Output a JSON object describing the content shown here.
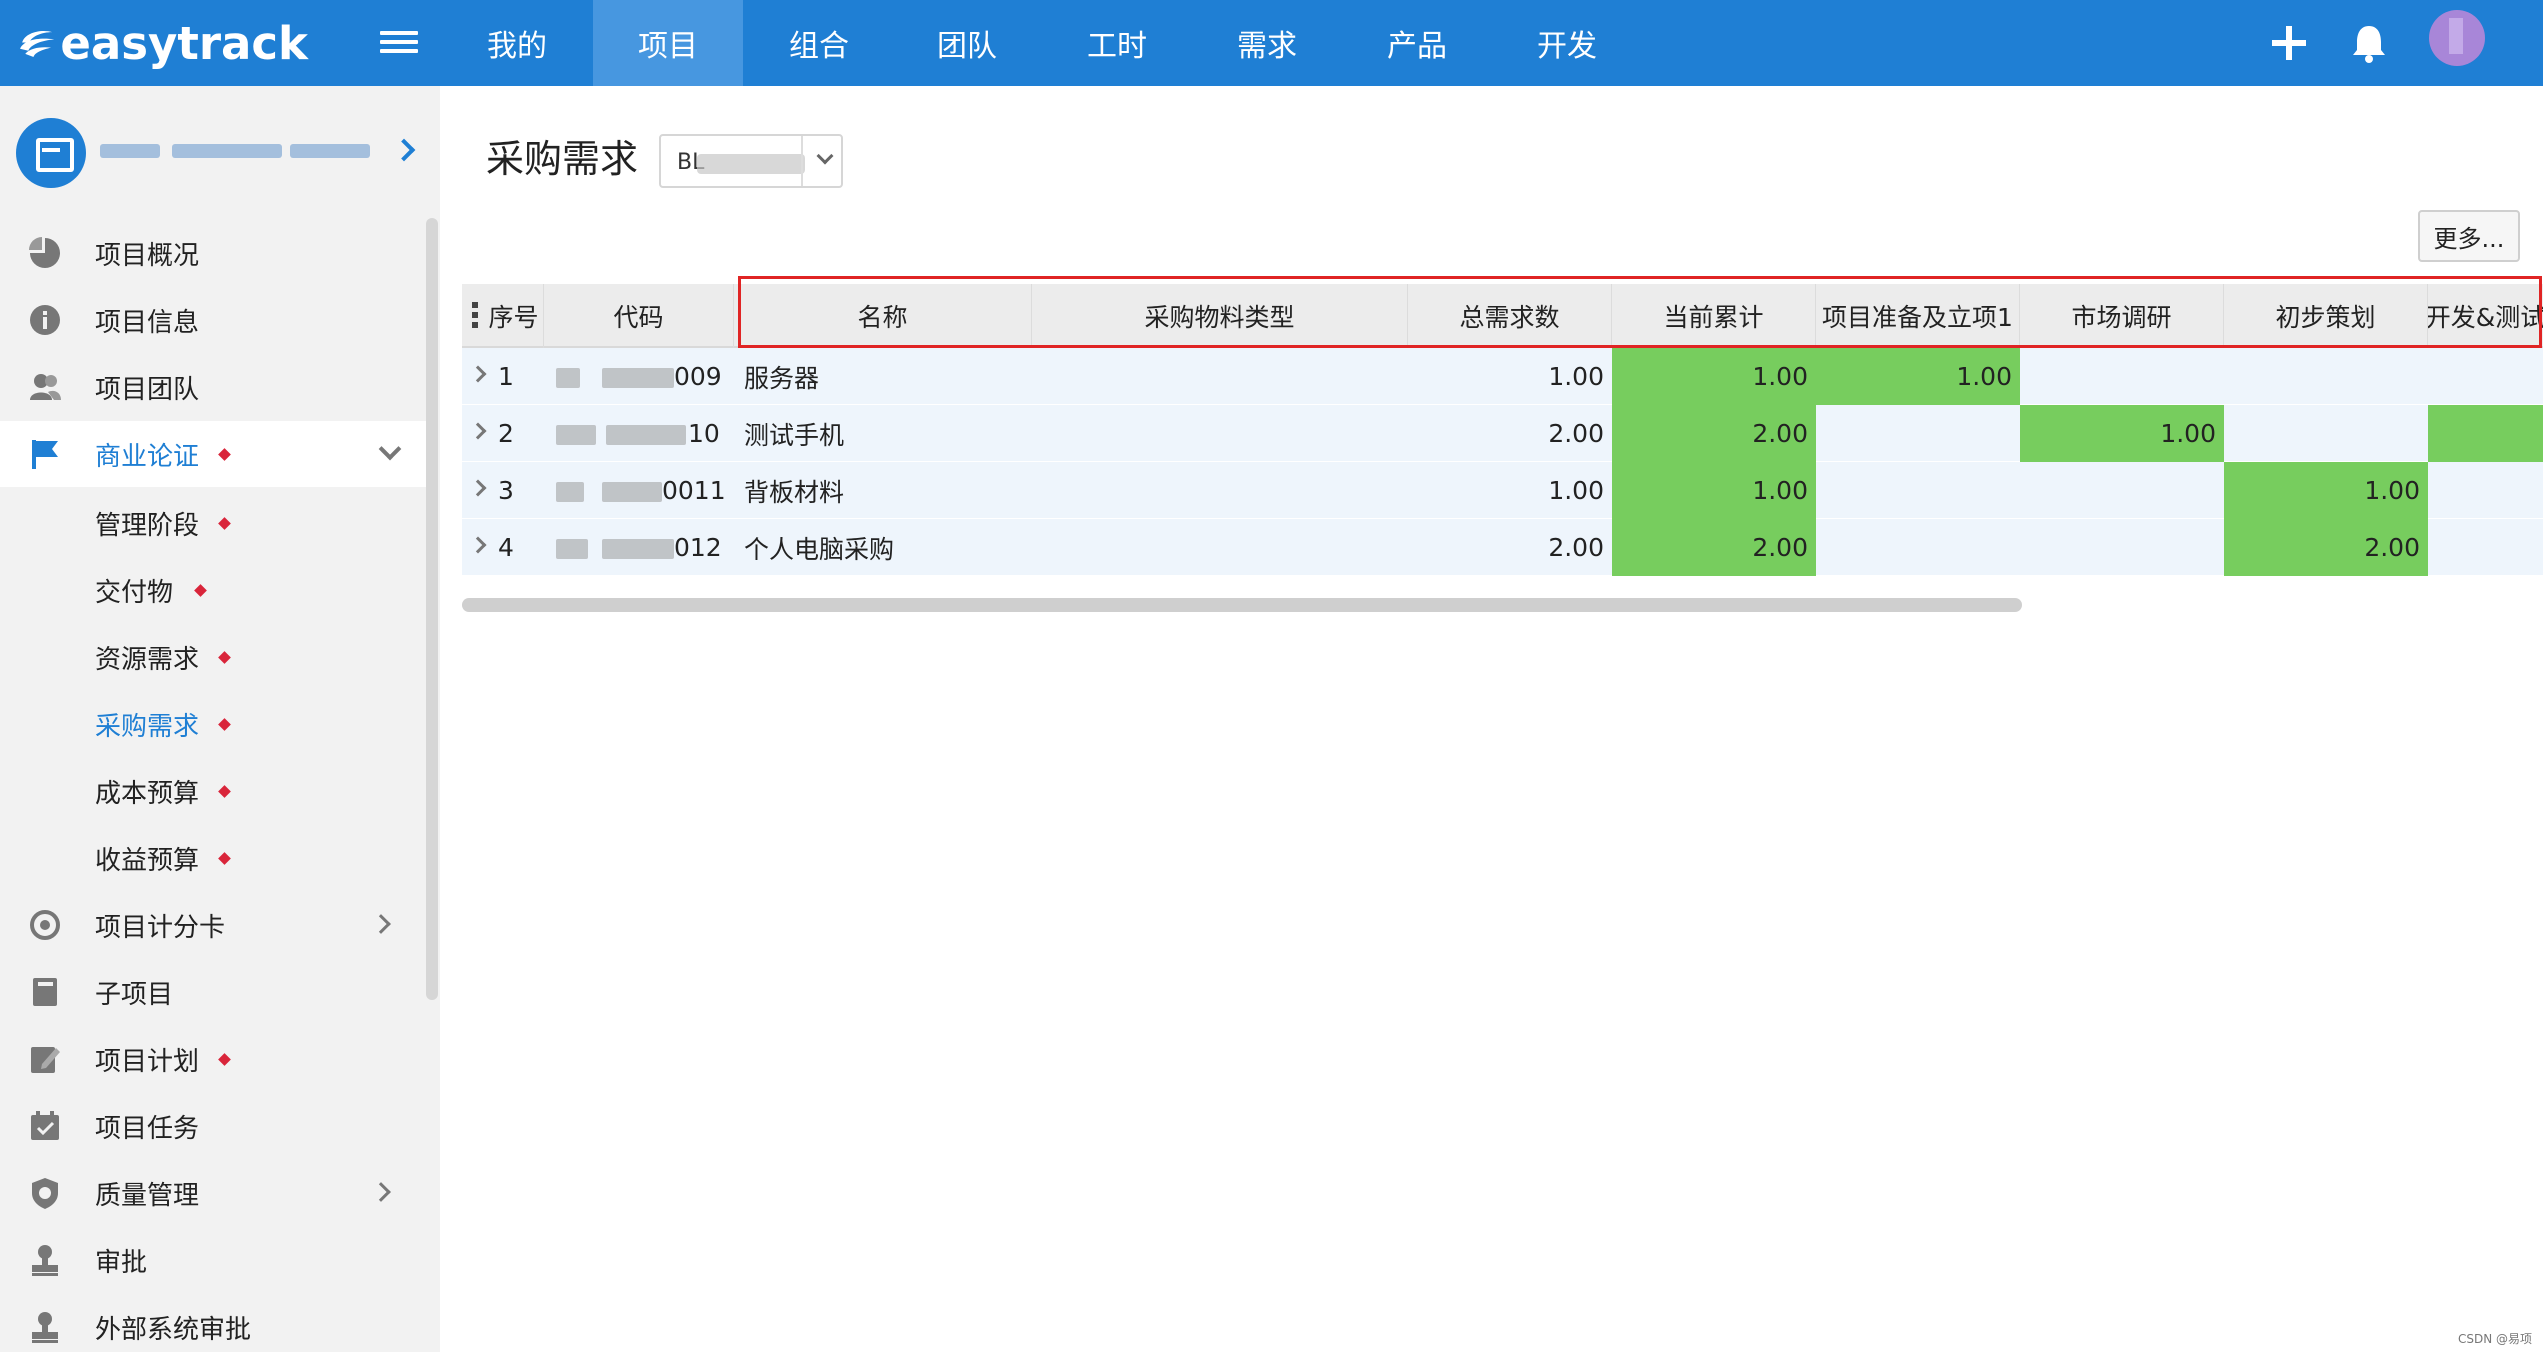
{
  "app": {
    "logo_text": "easytrack"
  },
  "nav": {
    "items": [
      {
        "label": "我的"
      },
      {
        "label": "项目"
      },
      {
        "label": "组合"
      },
      {
        "label": "团队"
      },
      {
        "label": "工时"
      },
      {
        "label": "需求"
      },
      {
        "label": "产品"
      },
      {
        "label": "开发"
      }
    ],
    "active_index": 1,
    "icons": [
      "plus-icon",
      "bell-icon",
      "avatar"
    ]
  },
  "sidebar": {
    "items": [
      {
        "label": "项目概况",
        "icon": "pie-chart-icon"
      },
      {
        "label": "项目信息",
        "icon": "info-icon"
      },
      {
        "label": "项目团队",
        "icon": "team-icon"
      },
      {
        "label": "商业论证",
        "icon": "flag-icon",
        "marked": true,
        "expanded": true
      },
      {
        "label": "项目计分卡",
        "icon": "target-icon"
      },
      {
        "label": "子项目",
        "icon": "book-icon"
      },
      {
        "label": "项目计划",
        "icon": "edit-icon",
        "marked": true
      },
      {
        "label": "项目任务",
        "icon": "calendar-check-icon"
      },
      {
        "label": "质量管理",
        "icon": "shield-icon"
      },
      {
        "label": "审批",
        "icon": "stamp-icon"
      },
      {
        "label": "外部系统审批",
        "icon": "stamp-icon"
      }
    ],
    "sub_items": [
      {
        "label": "管理阶段"
      },
      {
        "label": "交付物"
      },
      {
        "label": "资源需求"
      },
      {
        "label": "采购需求",
        "current": true
      },
      {
        "label": "成本预算"
      },
      {
        "label": "收益预算"
      }
    ]
  },
  "page": {
    "title": "采购需求",
    "version_value": "BL",
    "more_label": "更多..."
  },
  "table": {
    "columns": [
      "序号",
      "代码",
      "名称",
      "采购物料类型",
      "总需求数",
      "当前累计",
      "项目准备及立项1",
      "市场调研",
      "初步策划",
      "开发&测试"
    ],
    "rows": [
      {
        "index": "1",
        "code_suffix": "009",
        "name": "服务器",
        "material_type": "",
        "total": "1.00",
        "current": "1.00",
        "prep": "1.00",
        "market": "",
        "plan": "",
        "dev": ""
      },
      {
        "index": "2",
        "code_suffix": "10",
        "name": "测试手机",
        "material_type": "",
        "total": "2.00",
        "current": "2.00",
        "prep": "",
        "market": "1.00",
        "plan": "",
        "dev": ""
      },
      {
        "index": "3",
        "code_suffix": "0011",
        "name": "背板材料",
        "material_type": "",
        "total": "1.00",
        "current": "1.00",
        "prep": "",
        "market": "",
        "plan": "1.00",
        "dev": ""
      },
      {
        "index": "4",
        "code_suffix": "012",
        "name": "个人电脑采购",
        "material_type": "",
        "total": "2.00",
        "current": "2.00",
        "prep": "",
        "market": "",
        "plan": "2.00",
        "dev": ""
      }
    ],
    "highlight_color": "#77cd5e",
    "green_cells": [
      [
        "current",
        "prep"
      ],
      [
        "current",
        "market",
        "dev"
      ],
      [
        "current",
        "plan"
      ],
      [
        "current",
        "plan"
      ]
    ]
  },
  "colors": {
    "brand": "#1f7fd4",
    "nav_active": "#4797e0",
    "marker": "#d9253a",
    "annotation": "#e02424"
  },
  "watermark": "CSDN @易项"
}
